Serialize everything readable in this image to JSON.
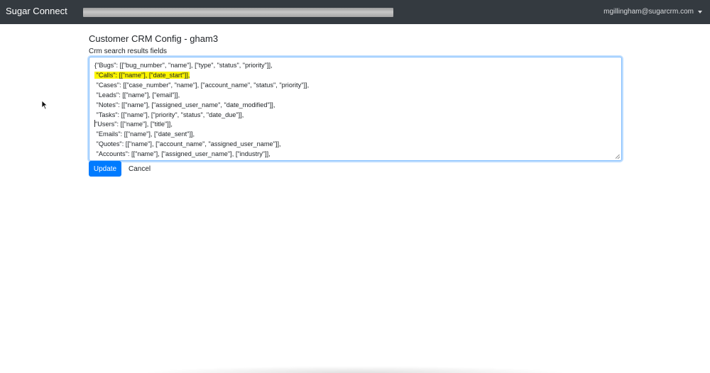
{
  "navbar": {
    "brand": "Sugar Connect",
    "user_email": "mgillingham@sugarcrm.com",
    "bg_color": "#343a40"
  },
  "page": {
    "title": "Customer CRM Config - gham3",
    "field_label": "Crm search results fields"
  },
  "editor": {
    "lines": [
      "{\"Bugs\": [[\"bug_number\", \"name\"], [\"type\", \"status\", \"priority\"]],",
      " \"Calls\": [[\"name\"], [\"date_start\"]],",
      " \"Cases\": [[\"case_number\", \"name\"], [\"account_name\", \"status\", \"priority\"]],",
      " \"Leads\": [[\"name\"], [\"email\"]],",
      " \"Notes\": [[\"name\"], [\"assigned_user_name\", \"date_modified\"]],",
      " \"Tasks\": [[\"name\"], [\"priority\", \"status\", \"date_due\"]],",
      "\"Users\": [[\"name\"], [\"title\"]],",
      " \"Emails\": [[\"name\"], [\"date_sent\"]],",
      " \"Quotes\": [[\"name\"], [\"account_name\", \"assigned_user_name\"]],",
      " \"Accounts\": [[\"name\"], [\"assigned_user_name\"], [\"industry\"]],"
    ],
    "highlight_color": "#fbf500"
  },
  "actions": {
    "update_label": "Update",
    "cancel_label": "Cancel",
    "primary_color": "#007bff"
  }
}
